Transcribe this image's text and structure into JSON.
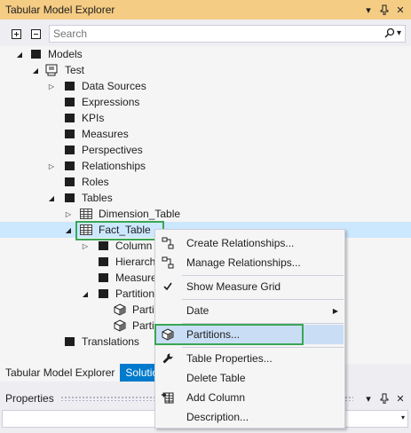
{
  "panel": {
    "title": "Tabular Model Explorer",
    "btn_dropdown": "▾",
    "btn_pin": "⊥",
    "btn_close": "✕"
  },
  "toolbar": {
    "search_placeholder": "Search",
    "search_dropdown": "▾"
  },
  "tree": {
    "models": "Models",
    "test": "Test",
    "data_sources": "Data Sources",
    "expressions": "Expressions",
    "kpis": "KPIs",
    "measures": "Measures",
    "perspectives": "Perspectives",
    "relationships": "Relationships",
    "roles": "Roles",
    "tables": "Tables",
    "dimension_table": "Dimension_Table",
    "fact_table": "Fact_Table",
    "columns": "Column",
    "hierarchies": "Hierarch",
    "fact_measures": "Measure",
    "partitions": "Partition",
    "partition_1": "Parti",
    "partition_2": "Parti",
    "translations": "Translations"
  },
  "tabs": {
    "explorer": "Tabular Model Explorer",
    "solution": "Solutio"
  },
  "properties": {
    "title": "Properties",
    "btn_dropdown": "▾",
    "btn_pin": "⊥",
    "btn_close": "✕",
    "combo_arrow": "▾"
  },
  "context_menu": {
    "create_relationships": "Create Relationships...",
    "manage_relationships": "Manage Relationships...",
    "show_measure_grid": "Show Measure Grid",
    "date": "Date",
    "partitions": "Partitions...",
    "table_properties": "Table Properties...",
    "delete_table": "Delete Table",
    "add_column": "Add Column",
    "description": "Description..."
  },
  "colors": {
    "title_bar": "#f5cc84",
    "selection": "#cce8ff",
    "highlight": "#3aa655",
    "tab_inactive": "#007acc",
    "menu_hot": "#c9def5"
  }
}
